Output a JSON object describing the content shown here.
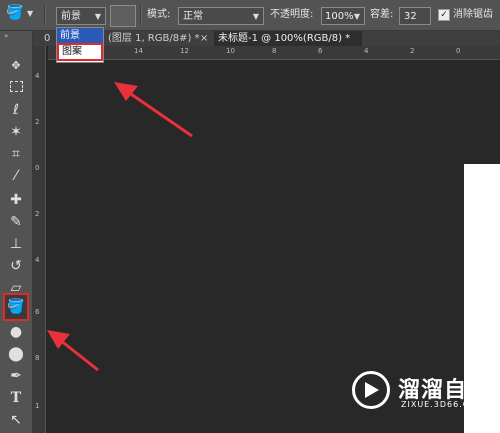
{
  "options_bar": {
    "source_select": "前景",
    "mode_label": "模式:",
    "mode_value": "正常",
    "opacity_label": "不透明度:",
    "opacity_value": "100%",
    "tolerance_label": "容差:",
    "tolerance_value": "32",
    "antialias_label": "消除锯齿",
    "antialias_checked": true
  },
  "source_dropdown": {
    "options": [
      "前景",
      "图案"
    ],
    "selected": "前景",
    "highlighted": "图案"
  },
  "tabs": [
    {
      "label": "0",
      "active": false
    },
    {
      "label": "(图层 1, RGB/8#) *",
      "active": false
    },
    {
      "label": "×",
      "active": false
    },
    {
      "label": "未标题-1 @ 100%(RGB/8) *",
      "active": true
    },
    {
      "label": "×",
      "active": true
    }
  ],
  "ruler_h": [
    "16",
    "14",
    "12",
    "10",
    "8",
    "6",
    "4",
    "2",
    "0"
  ],
  "ruler_v": [
    "4",
    "2",
    "0",
    "2",
    "4",
    "6",
    "8",
    "1"
  ],
  "tools": [
    "move-tool",
    "marquee-tool",
    "lasso-tool",
    "magic-wand-tool",
    "crop-tool",
    "eyedropper-tool",
    "healing-brush-tool",
    "brush-tool",
    "clone-stamp-tool",
    "history-brush-tool",
    "eraser-tool",
    "paint-bucket-tool",
    "blur-tool",
    "dodge-tool",
    "pen-tool",
    "type-tool",
    "path-selection-tool"
  ],
  "active_tool": "paint-bucket-tool",
  "watermark": {
    "title": "溜溜自学",
    "url": "ZIXUE.3D66.COM"
  },
  "colors": {
    "highlight": "#e0282f",
    "arrow": "#e8313a",
    "selection": "#2a5ab8"
  }
}
